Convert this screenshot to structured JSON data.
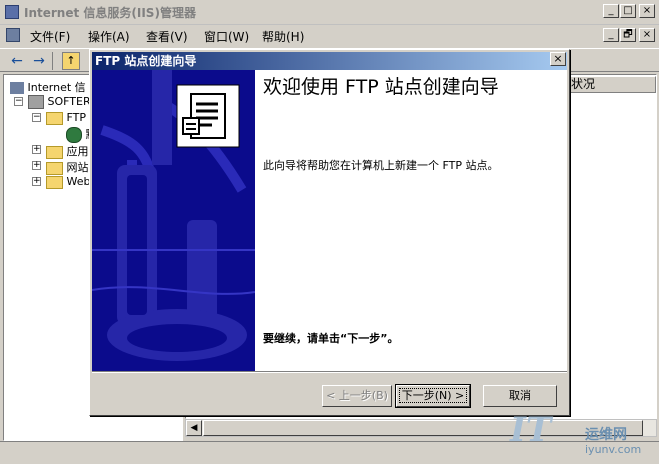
{
  "window": {
    "title": "Internet 信息服务(IIS)管理器",
    "controls": [
      "_",
      "□",
      "×"
    ],
    "mdi_controls": [
      "_",
      "🗗",
      "×"
    ]
  },
  "menu": {
    "items": [
      "文件(F)",
      "操作(A)",
      "查看(V)",
      "窗口(W)",
      "帮助(H)"
    ]
  },
  "toolbar": {
    "icons": [
      "back-arrow-icon",
      "forward-arrow-icon",
      "up-folder-icon"
    ]
  },
  "tree": {
    "nodes": [
      {
        "label": "Internet 信"
      },
      {
        "label": "SOFTER"
      },
      {
        "label": "FTP"
      },
      {
        "label": "默"
      },
      {
        "label": "应用"
      },
      {
        "label": "网站"
      },
      {
        "label": "Web"
      }
    ]
  },
  "rightpane": {
    "column_header": "状况"
  },
  "wizard": {
    "title": "FTP 站点创建向导",
    "close": "×",
    "heading": "欢迎使用 FTP 站点创建向导",
    "description": "此向导将帮助您在计算机上新建一个 FTP 站点。",
    "continue_text": "要继续，请单击“下一步”。",
    "buttons": {
      "back": "< 上一步(B)",
      "next": "下一步(N) >",
      "cancel": "取消"
    },
    "banner_color": "#0b0b8c"
  },
  "watermark": {
    "site": "运维网",
    "url": "iyunv.com"
  },
  "colors": {
    "titlebar_active_start": "#0a246a",
    "titlebar_active_end": "#a6caf0",
    "face": "#d4d0c8"
  }
}
